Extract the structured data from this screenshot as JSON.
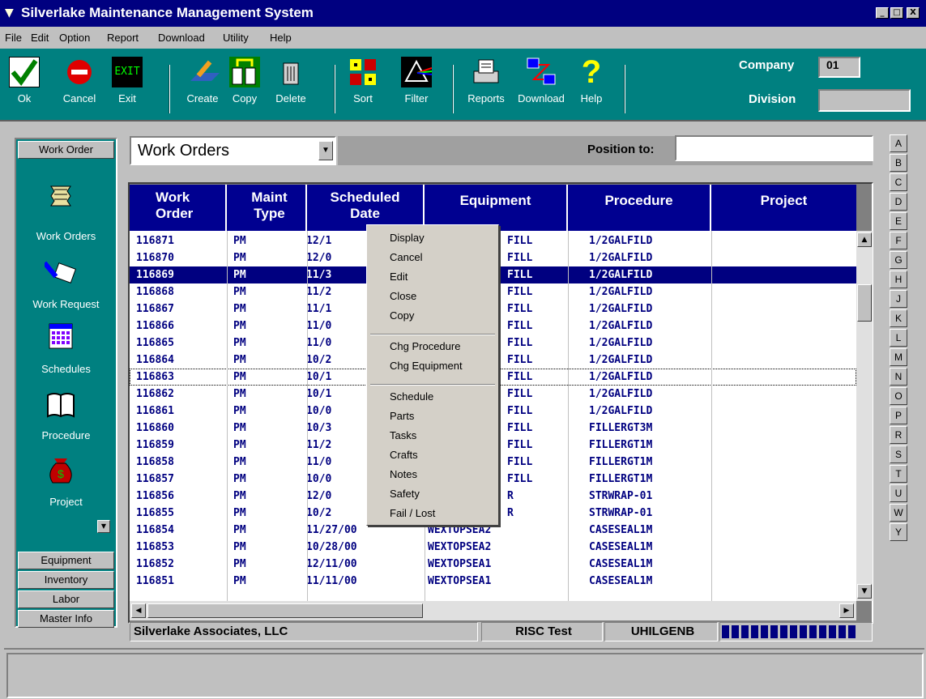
{
  "window": {
    "title": "Silverlake Maintenance Management System",
    "minimize": "_",
    "maximize": "□",
    "close": "X"
  },
  "menu": [
    "File",
    "Edit",
    "Option",
    "Report",
    "Download",
    "Utility",
    "Help"
  ],
  "toolbar": {
    "ok": "Ok",
    "cancel": "Cancel",
    "exit": "Exit",
    "exit_icon_text": "EXIT",
    "create": "Create",
    "copy": "Copy",
    "delete": "Delete",
    "sort": "Sort",
    "filter": "Filter",
    "reports": "Reports",
    "download": "Download",
    "help": "Help",
    "company_label": "Company",
    "company_value": "01",
    "division_label": "Division",
    "division_value": ""
  },
  "nav": {
    "top_tab": "Work Order",
    "items": [
      "Work Orders",
      "Work Request",
      "Schedules",
      "Procedure",
      "Project"
    ],
    "bottom_tabs": [
      "Equipment",
      "Inventory",
      "Labor",
      "Master Info"
    ]
  },
  "view": {
    "selected": "Work Orders",
    "position_label": "Position to:",
    "position_value": ""
  },
  "grid": {
    "headers": [
      [
        "Work",
        "Order"
      ],
      [
        "Maint",
        "Type"
      ],
      [
        "Scheduled",
        "Date"
      ],
      [
        "",
        "Equipment"
      ],
      [
        "",
        "Procedure"
      ],
      [
        "",
        "Project"
      ]
    ],
    "rows": [
      [
        "116871",
        "PM",
        "12/1",
        "FILL",
        "1/2GALFILD"
      ],
      [
        "116870",
        "PM",
        "12/0",
        "FILL",
        "1/2GALFILD"
      ],
      [
        "116869",
        "PM",
        "11/3",
        "FILL",
        "1/2GALFILD"
      ],
      [
        "116868",
        "PM",
        "11/2",
        "FILL",
        "1/2GALFILD"
      ],
      [
        "116867",
        "PM",
        "11/1",
        "FILL",
        "1/2GALFILD"
      ],
      [
        "116866",
        "PM",
        "11/0",
        "FILL",
        "1/2GALFILD"
      ],
      [
        "116865",
        "PM",
        "11/0",
        "FILL",
        "1/2GALFILD"
      ],
      [
        "116864",
        "PM",
        "10/2",
        "FILL",
        "1/2GALFILD"
      ],
      [
        "116863",
        "PM",
        "10/1",
        "FILL",
        "1/2GALFILD"
      ],
      [
        "116862",
        "PM",
        "10/1",
        "FILL",
        "1/2GALFILD"
      ],
      [
        "116861",
        "PM",
        "10/0",
        "FILL",
        "1/2GALFILD"
      ],
      [
        "116860",
        "PM",
        "10/3",
        "FILL",
        "FILLERGT3M"
      ],
      [
        "116859",
        "PM",
        "11/2",
        "FILL",
        "FILLERGT1M"
      ],
      [
        "116858",
        "PM",
        "11/0",
        "FILL",
        "FILLERGT1M"
      ],
      [
        "116857",
        "PM",
        "10/0",
        "FILL",
        "FILLERGT1M"
      ],
      [
        "116856",
        "PM",
        "12/0",
        "R",
        "STRWRAP-01"
      ],
      [
        "116855",
        "PM",
        "10/2",
        "R",
        "STRWRAP-01"
      ],
      [
        "116854",
        "PM",
        "11/27/00",
        "WEXTOPSEA2",
        "CASESEAL1M"
      ],
      [
        "116853",
        "PM",
        "10/28/00",
        "WEXTOPSEA2",
        "CASESEAL1M"
      ],
      [
        "116852",
        "PM",
        "12/11/00",
        "WEXTOPSEA1",
        "CASESEAL1M"
      ],
      [
        "116851",
        "PM",
        "11/11/00",
        "WEXTOPSEA1",
        "CASESEAL1M"
      ]
    ]
  },
  "context_menu": {
    "group1": [
      "Display",
      "Cancel",
      "Edit",
      "Close",
      "Copy"
    ],
    "group2": [
      "Chg Procedure",
      "Chg Equipment"
    ],
    "group3": [
      "Schedule",
      "Parts",
      "Tasks",
      "Crafts",
      "Notes",
      "Safety",
      "Fail / Lost"
    ]
  },
  "status": {
    "company": "Silverlake Associates, LLC",
    "env": "RISC Test",
    "user": "UHILGENB"
  },
  "alphabet": [
    "A",
    "B",
    "C",
    "D",
    "E",
    "F",
    "G",
    "H",
    "J",
    "K",
    "L",
    "M",
    "N",
    "O",
    "P",
    "R",
    "S",
    "T",
    "U",
    "W",
    "Y"
  ]
}
